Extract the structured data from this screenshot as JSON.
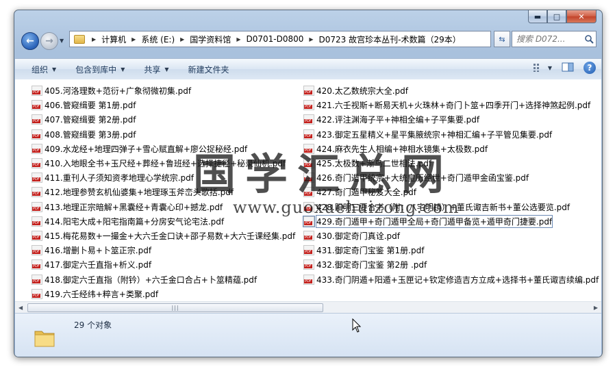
{
  "window": {
    "controls": {
      "minimize": "▬",
      "maximize": "□",
      "close": "✕"
    }
  },
  "nav": {
    "back_icon": "←",
    "forward_icon": "→",
    "breadcrumbs": [
      "计算机",
      "系统 (E:)",
      "国学资料馆",
      "D0701-D0800",
      "D0723 故宫珍本丛刊-术数篇（29本）"
    ],
    "search_placeholder": "搜索 D072..."
  },
  "toolbar": {
    "organize": "组织",
    "include_in_library": "包含到库中",
    "share": "共享",
    "new_folder": "新建文件夹"
  },
  "files": {
    "left": [
      "405.河洛理数+范衍+广象彻微初集.pdf",
      "406.管窥缉要 第1册.pdf",
      "407.管窥缉要 第2册.pdf",
      "408.管窥缉要 第3册.pdf",
      "409.水龙经+地理四弹子+雪心赋直解+廖公捉秘经.pdf",
      "410.入地眼全书+玉尺经+葬经+鲁班经+选择捷径+秘录仙机.pdf",
      "411.重刊人子须知资孝地理心学统宗.pdf",
      "412.地理参赞玄机仙婆集+地理琢玉斧峦头歌括.pdf",
      "413.地理正宗暗解+黑囊经+青囊心印+撼龙.pdf",
      "414.阳宅大成+阳宅指南篇+分房安气论宅法.pdf",
      "415.梅花易数+一撮金+大六壬金口诀+邵子易数+大六壬课经集.pdf",
      "416.增删卜易+卜筮正宗.pdf",
      "417.御定六壬直指+析义.pdf",
      "418.御定六壬直指（附钤）+六壬金口合占+卜筮精蕴.pdf",
      "419.六壬经纬+粹言+类聚.pdf"
    ],
    "right": [
      "420.太乙数统宗大全.pdf",
      "421.六壬视斯+断易天机+火珠林+奇门卜筮+四季开门+选择神煞起例.pdf",
      "422.评注渊海子平+神相全编+子平集要.pdf",
      "423.御定五星精义+星平集腋统宗+神相汇编+子平管见集要.pdf",
      "424.麻衣先生人相编+神相水镜集+太极数.pdf",
      "425.太极数+渐鸟二世相法.pdf",
      "426.奇门遁甲统宗+大统皇历经世+奇门遁甲金函宝鉴.pdf",
      "427.奇门遁甲秘笈大全.pdf",
      "428.阳明三要合书（附：八宅明镜）+董氏诹吉新书+董公选要览.pdf",
      "429.奇门遁甲+奇门遁甲全局+奇门遁甲备览+遁甲奇门捷要.pdf",
      "430.御定奇门真诠.pdf",
      "431.御定奇门宝鉴 第1册.pdf",
      "432.御定奇门宝鉴 第2册 .pdf",
      "433.奇门阴遁+阳遁+玉匣记+钦定修造吉方立成+选择书+董氏诹吉续编.pdf"
    ]
  },
  "status": {
    "count": "29 个对象"
  },
  "watermark": {
    "title": "国学汇总网",
    "url": "www.guoxuehuizong.com"
  }
}
